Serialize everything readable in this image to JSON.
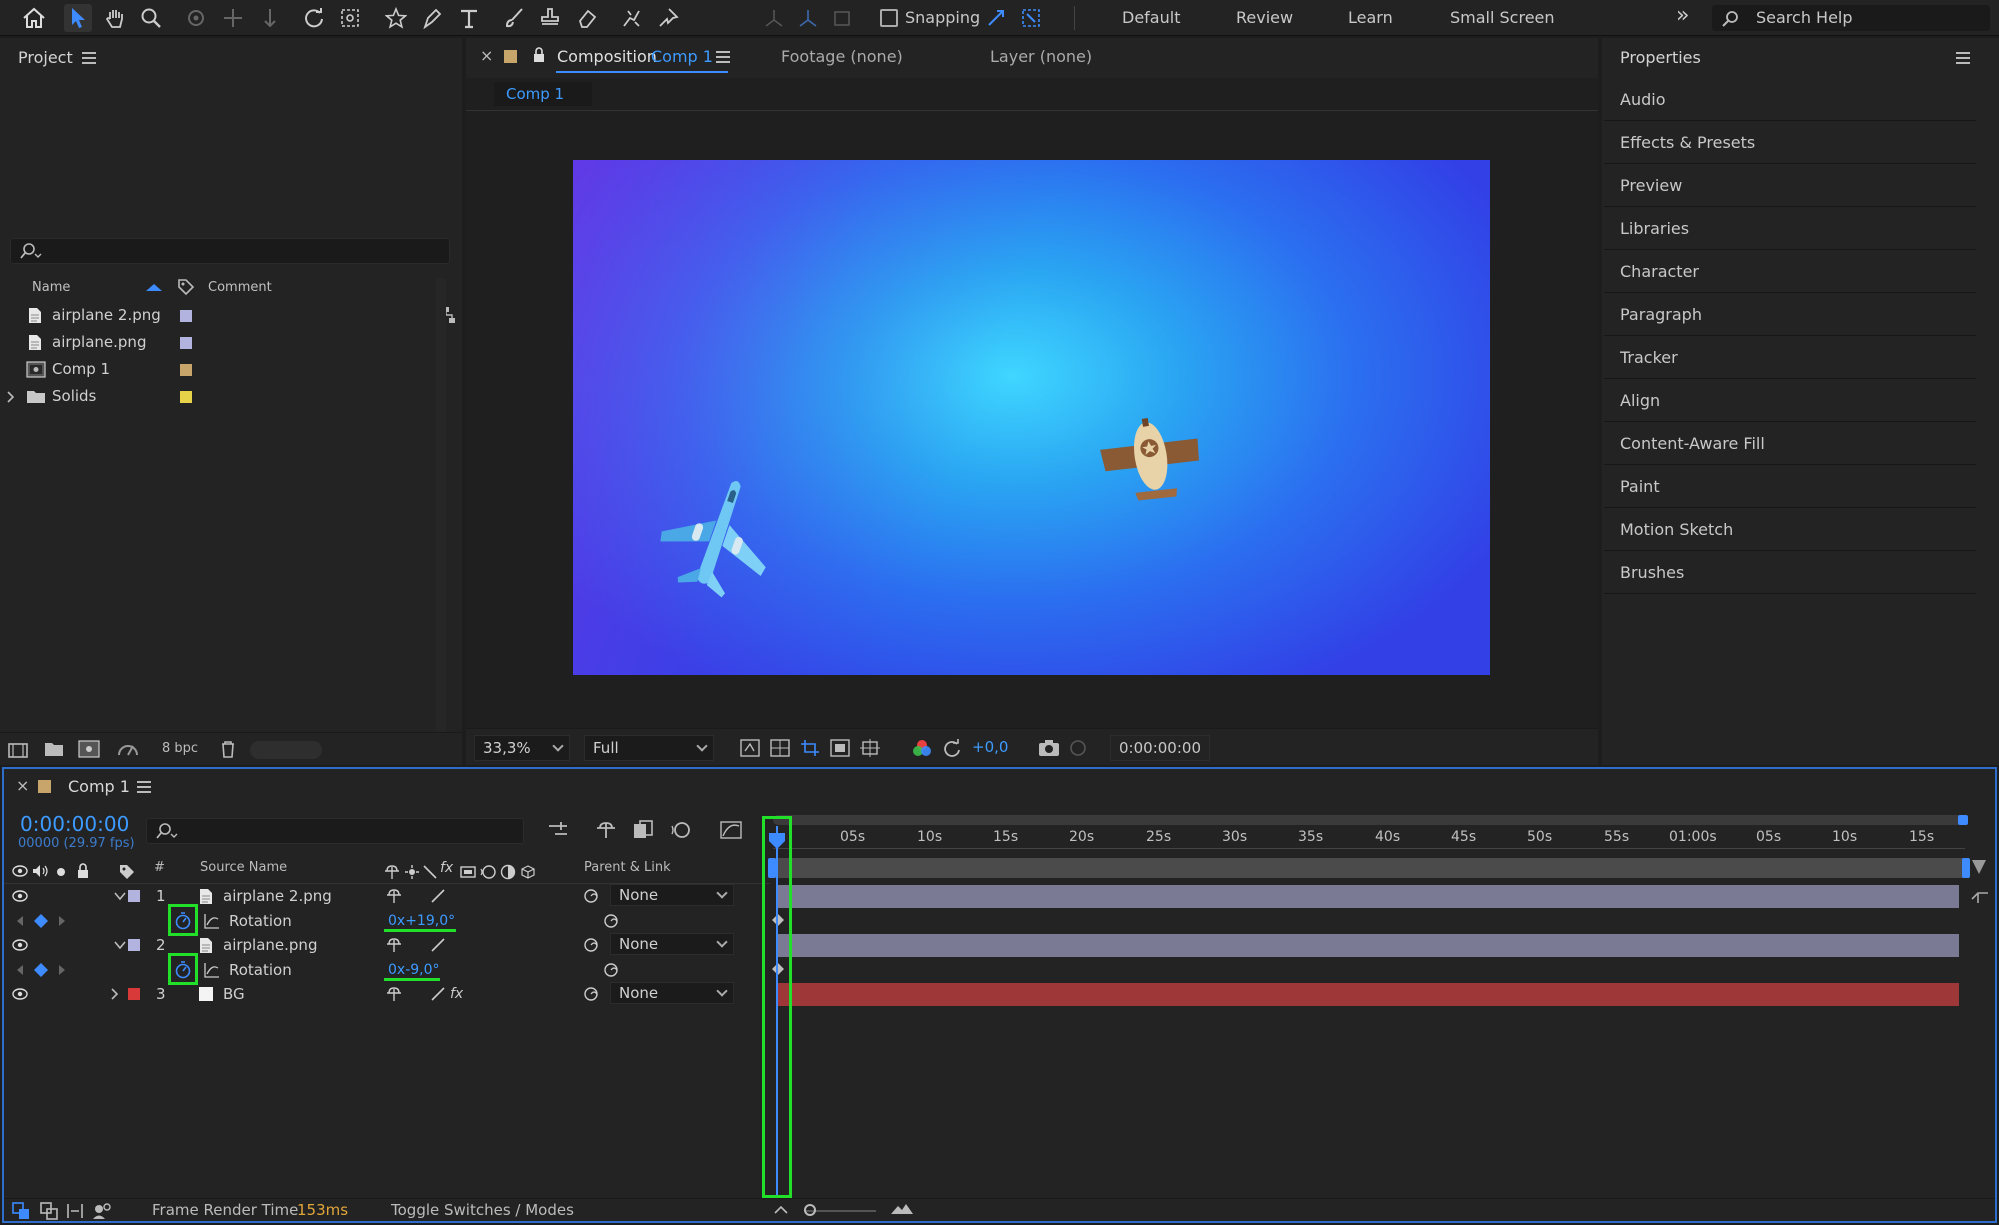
{
  "toolbar": {
    "snapping_label": "Snapping",
    "workspaces": [
      "Default",
      "Review",
      "Learn",
      "Small Screen"
    ],
    "search_placeholder": "Search Help"
  },
  "project": {
    "title": "Project",
    "columns": {
      "name": "Name",
      "comment": "Comment"
    },
    "items": [
      {
        "name": "airplane 2.png",
        "color": "#b3b3e0"
      },
      {
        "name": "airplane.png",
        "color": "#b3b3e0"
      },
      {
        "name": "Comp 1",
        "color": "#c8a66b"
      },
      {
        "name": "Solids",
        "color": "#e6d34a"
      }
    ],
    "bpc": "8 bpc"
  },
  "composition": {
    "tab_prefix": "Composition",
    "tab_name": "Comp 1",
    "footage_tab": "Footage (none)",
    "layer_tab": "Layer (none)",
    "breadcrumb": "Comp 1",
    "zoom": "33,3%",
    "resolution": "Full",
    "exposure": "+0,0",
    "timecode": "0:00:00:00"
  },
  "properties": {
    "title": "Properties",
    "items": [
      "Audio",
      "Effects & Presets",
      "Preview",
      "Libraries",
      "Character",
      "Paragraph",
      "Tracker",
      "Align",
      "Content-Aware Fill",
      "Paint",
      "Motion Sketch",
      "Brushes"
    ]
  },
  "timeline": {
    "tab": "Comp 1",
    "timecode": "0:00:00:00",
    "frame_info": "00000 (29.97 fps)",
    "col_num": "#",
    "col_source": "Source Name",
    "col_parent": "Parent & Link",
    "ruler": [
      "05s",
      "10s",
      "15s",
      "20s",
      "25s",
      "30s",
      "35s",
      "40s",
      "45s",
      "50s",
      "55s",
      "01:00s",
      "05s",
      "10s",
      "15s"
    ],
    "layers": [
      {
        "num": "1",
        "name": "airplane 2.png",
        "color": "#b3b3e0",
        "parent": "None",
        "prop": "Rotation",
        "value": "0x+19,0°"
      },
      {
        "num": "2",
        "name": "airplane.png",
        "color": "#b3b3e0",
        "parent": "None",
        "prop": "Rotation",
        "value": "0x-9,0°"
      },
      {
        "num": "3",
        "name": "BG",
        "color": "#d83a3a",
        "parent": "None"
      }
    ],
    "footer": {
      "render_label": "Frame Render Time",
      "render_value": "153ms",
      "toggle": "Toggle Switches / Modes"
    }
  }
}
